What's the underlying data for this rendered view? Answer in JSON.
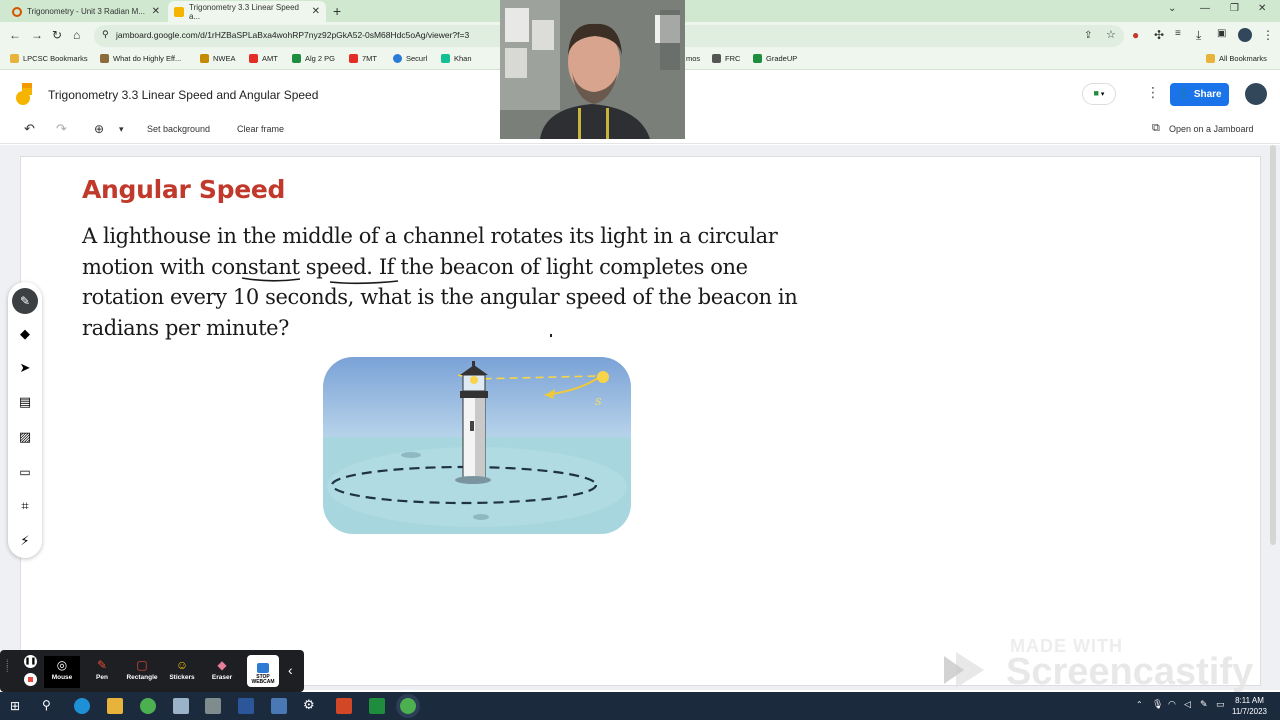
{
  "browser": {
    "tabs": [
      {
        "title": "Trigonometry - Unit 3 Radian M..."
      },
      {
        "title": "Trigonometry 3.3 Linear Speed a..."
      }
    ],
    "url": "jamboard.google.com/d/1rHZBaSPLaBxa4wohRP7nyz92pGkA52-0sM68Hdc5oAg/viewer?f=3",
    "bookmarks": [
      "LPCSC Bookmarks",
      "What do Highly Eff...",
      "NWEA",
      "AMT",
      "Alg 2 PG",
      "7MT",
      "Securl",
      "Khan",
      "mos",
      "FRC",
      "GradeUP"
    ],
    "all_bookmarks": "All Bookmarks"
  },
  "app": {
    "title": "Trigonometry 3.3 Linear Speed and Angular Speed",
    "share_label": "Share"
  },
  "toolbar": {
    "set_background": "Set background",
    "clear_frame": "Clear frame",
    "open_jamboard": "Open on a Jamboard"
  },
  "content": {
    "heading": "Angular Speed",
    "lines": [
      "A lighthouse in the middle of a channel rotates its light in a circular",
      "motion with constant speed. If the beacon of light completes one",
      "rotation every 10 seconds, what is the angular speed of the beacon in",
      "radians per minute?"
    ],
    "figure_label": "s"
  },
  "screencastify": {
    "buttons": [
      "Mouse",
      "Pen",
      "Rectangle",
      "Stickers",
      "Eraser"
    ],
    "stop_label": "STOP\nWEBCAM",
    "watermark_top": "MADE WITH",
    "watermark_brand": "Screencastify"
  },
  "taskbar": {
    "time": "8:11 AM",
    "date": "11/7/2023"
  },
  "colors": {
    "accent": "#1a73e8",
    "heading": "#c0392b",
    "chrome_frame": "#cfe8cf"
  }
}
